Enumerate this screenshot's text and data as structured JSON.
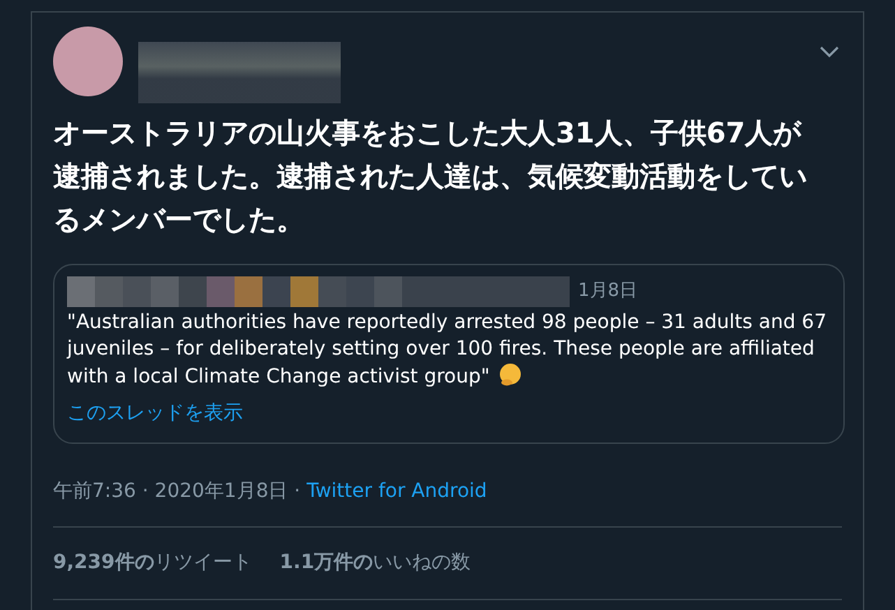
{
  "tweet": {
    "text": "オーストラリアの山火事をおこした大人31人、子供67人が逮捕されました。逮捕された人達は、気候変動活動をしているメンバーでした。",
    "quote": {
      "date": "1月8日",
      "text": "\"Australian authorities have reportedly arrested  98 people – 31 adults and 67 juveniles – for deliberately setting over 100 fires. These people are  affiliated with a local Climate Change activist group\"",
      "thread_link": "このスレッドを表示"
    },
    "time": "午前7:36 · 2020年1月8日 · ",
    "source": "Twitter for Android",
    "stats": [
      {
        "text": "**9,239件の**リツイート"
      },
      {
        "text": "**1.1万件の**いいねの数"
      }
    ]
  }
}
